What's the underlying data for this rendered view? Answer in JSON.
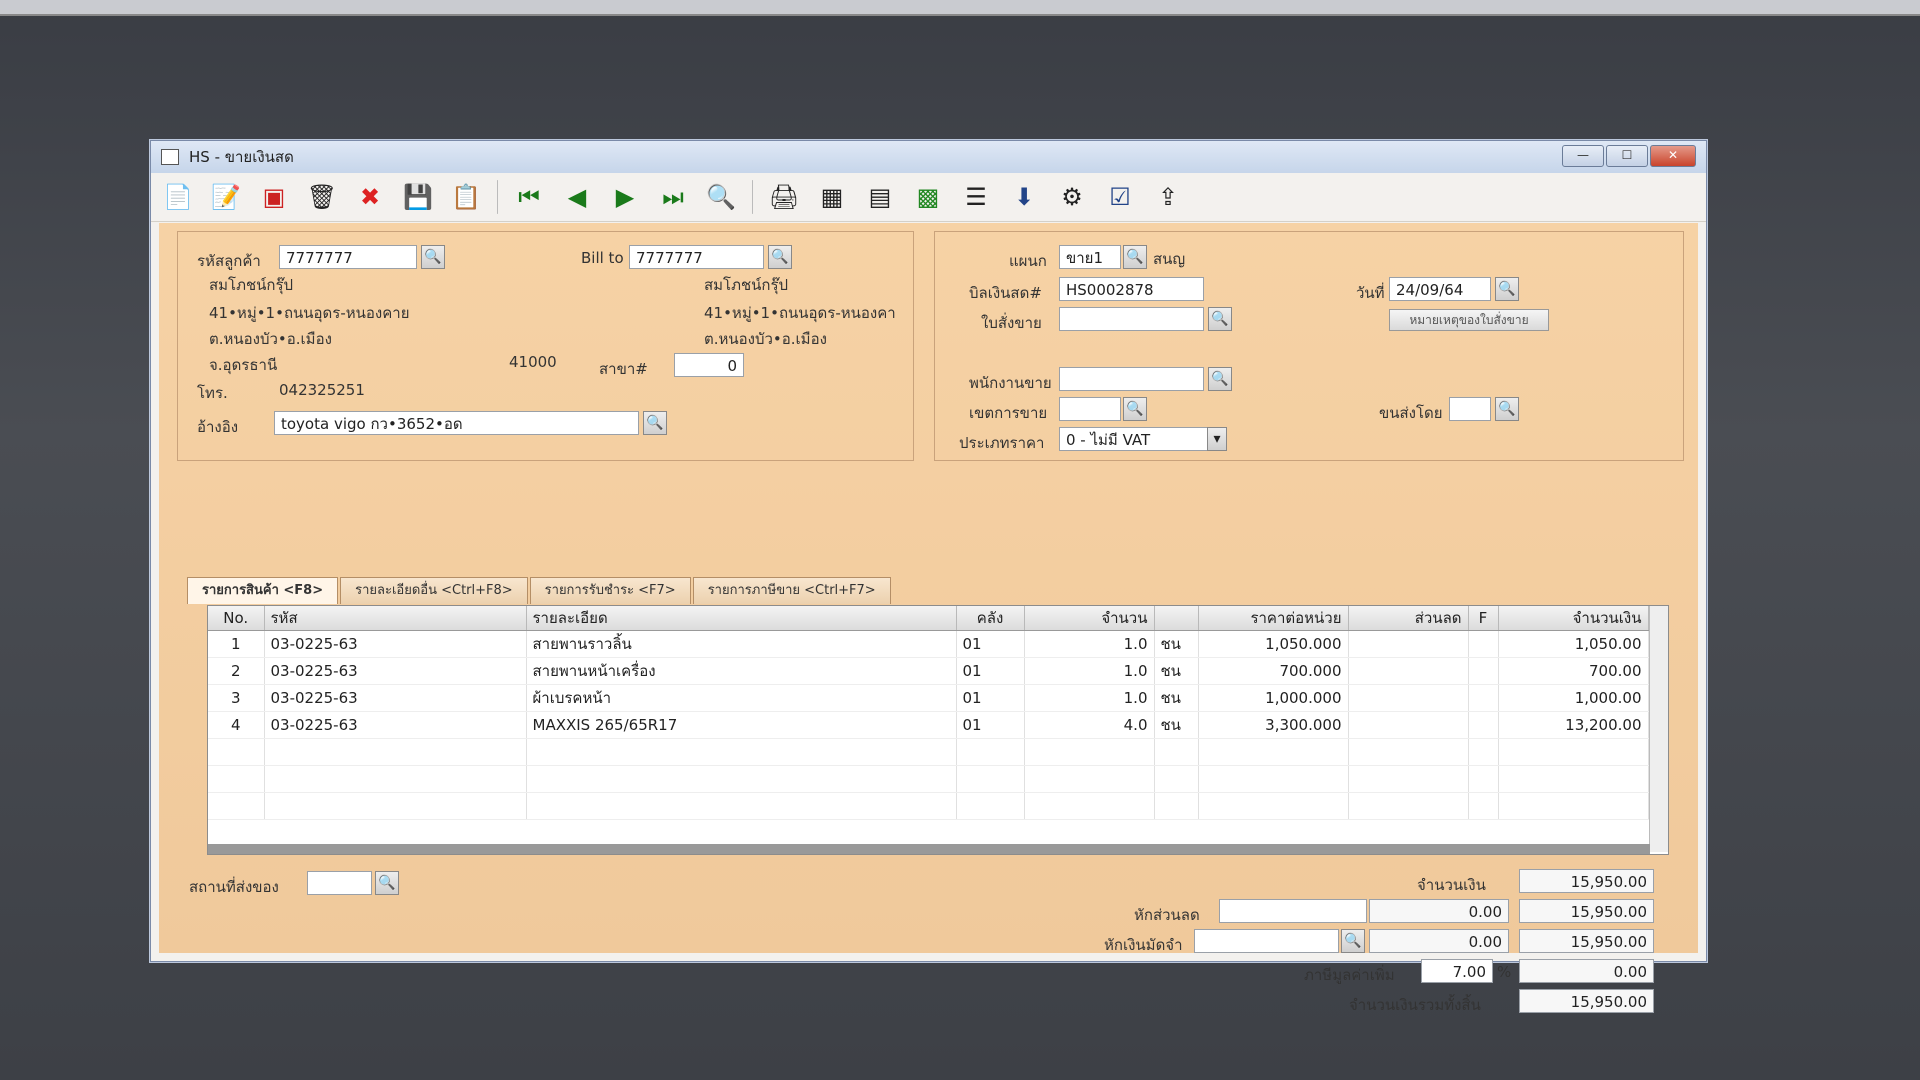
{
  "window": {
    "title": "HS - ขายเงินสด"
  },
  "toolbar": {
    "icons": [
      "new-icon",
      "edit-icon",
      "void-icon",
      "delete-icon",
      "cancel-icon",
      "save-icon",
      "copy-icon",
      "first-icon",
      "prev-icon",
      "next-icon",
      "last-icon",
      "find-icon",
      "print-icon",
      "calc-icon",
      "form-icon",
      "total-icon",
      "list-icon",
      "approve-icon",
      "tool-icon",
      "ok-icon",
      "export-icon"
    ]
  },
  "customer": {
    "code_label": "รหัสลูกค้า",
    "code": "7777777",
    "name": "สมโภชน์กรุ๊ป",
    "addr1": "41•หมู่•1•ถนนอุดร-หนองคาย",
    "addr2": "ต.หนองบัว•อ.เมือง",
    "addr3": "จ.อุดรธานี",
    "zip": "41000",
    "phone_label": "โทร.",
    "phone": "042325251",
    "ref_label": "อ้างอิง",
    "ref": "toyota vigo กว•3652•อด",
    "branch_label": "สาขา#",
    "branch": "0"
  },
  "billto": {
    "label": "Bill to",
    "code": "7777777",
    "name": "สมโภชน์กรุ๊ป",
    "addr1": "41•หมู่•1•ถนนอุดร-หนองคา",
    "addr2": "ต.หนองบัว•อ.เมือง"
  },
  "doc": {
    "dept_label": "แผนก",
    "dept": "ขาย1",
    "dept_name": "สนญ",
    "bill_label": "บิลเงินสด#",
    "bill": "HS0002878",
    "date_label": "วันที่",
    "date": "24/09/64",
    "so_label": "ใบสั่งขาย",
    "so": "",
    "so_note_button": "หมายเหตุของใบสั่งขาย",
    "salesman_label": "พนักงานขาย",
    "area_label": "เขตการขาย",
    "ship_label": "ขนส่งโดย",
    "price_type_label": "ประเภทราคา",
    "price_type": "0 - ไม่มี VAT"
  },
  "tabs": [
    "รายการสินค้า <F8>",
    "รายละเอียดอื่น <Ctrl+F8>",
    "รายการรับชำระ <F7>",
    "รายการภาษีขาย <Ctrl+F7>"
  ],
  "grid": {
    "headers": [
      "No.",
      "รหัส",
      "รายละเอียด",
      "คลัง",
      "จำนวน",
      "",
      "ราคาต่อหน่วย",
      "ส่วนลด",
      "F",
      "จำนวนเงิน"
    ],
    "rows": [
      [
        "1",
        "03-0225-63",
        "สายพานราวลิ้น",
        "01",
        "1.0",
        "ชน",
        "1,050.000",
        "",
        "",
        "1,050.00"
      ],
      [
        "2",
        "03-0225-63",
        "สายพานหน้าเครื่อง",
        "01",
        "1.0",
        "ชน",
        "700.000",
        "",
        "",
        "700.00"
      ],
      [
        "3",
        "03-0225-63",
        "ผ้าเบรคหน้า",
        "01",
        "1.0",
        "ชน",
        "1,000.000",
        "",
        "",
        "1,000.00"
      ],
      [
        "4",
        "03-0225-63",
        "MAXXIS 265/65R17",
        "01",
        "4.0",
        "ชน",
        "3,300.000",
        "",
        "",
        "13,200.00"
      ]
    ]
  },
  "footer": {
    "deliver_label": "สถานที่ส่งของ",
    "amount_label": "จำนวนเงิน",
    "amount": "15,950.00",
    "discount_label": "หักส่วนลด",
    "discount_value": "0.00",
    "after_discount": "15,950.00",
    "deposit_label": "หักเงินมัดจำ",
    "deposit_value": "0.00",
    "after_deposit": "15,950.00",
    "vat_label": "ภาษีมูลค่าเพิ่ม",
    "vat_rate": "7.00",
    "vat_pct": "%",
    "vat_value": "0.00",
    "grand_label": "จำนวนเงินรวมทั้งสิ้น",
    "grand_total": "15,950.00"
  }
}
